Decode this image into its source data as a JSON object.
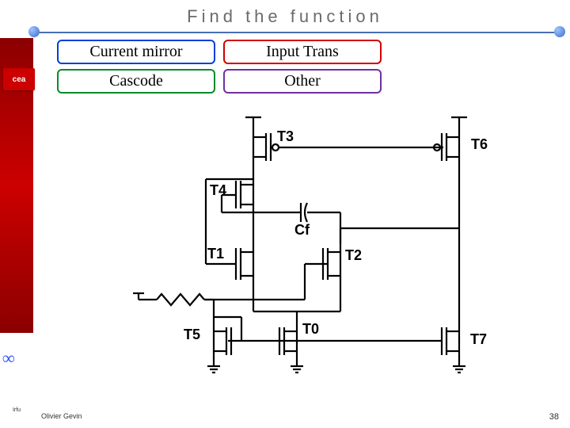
{
  "title": "Find the function",
  "legend": {
    "tl": "Current mirror",
    "tr": "Input Trans",
    "bl": "Cascode",
    "br": "Other"
  },
  "logos": {
    "cea": "cea",
    "irfu": "Irfu"
  },
  "circuit_labels": {
    "T0": "T0",
    "T1": "T1",
    "T2": "T2",
    "T3": "T3",
    "T4": "T4",
    "T5": "T5",
    "T6": "T6",
    "T7": "T7",
    "Cf": "Cf"
  },
  "footer": {
    "author": "Olivier Gevin",
    "page": "38"
  }
}
